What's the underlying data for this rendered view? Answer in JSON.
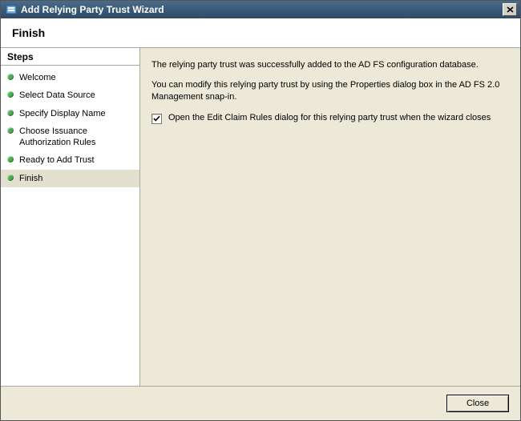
{
  "window": {
    "title": "Add Relying Party Trust Wizard"
  },
  "header": {
    "title": "Finish"
  },
  "sidebar": {
    "heading": "Steps",
    "items": [
      {
        "label": "Welcome",
        "active": false
      },
      {
        "label": "Select Data Source",
        "active": false
      },
      {
        "label": "Specify Display Name",
        "active": false
      },
      {
        "label": "Choose Issuance Authorization Rules",
        "active": false
      },
      {
        "label": "Ready to Add Trust",
        "active": false
      },
      {
        "label": "Finish",
        "active": true
      }
    ]
  },
  "content": {
    "line1": "The relying party trust was successfully added to the AD FS configuration database.",
    "line2": "You can modify this relying party trust by using the Properties dialog box in the AD FS 2.0 Management snap-in.",
    "checkbox": {
      "checked": true,
      "label": "Open the Edit Claim Rules dialog for this relying party trust when the wizard closes"
    }
  },
  "buttons": {
    "close": "Close"
  }
}
